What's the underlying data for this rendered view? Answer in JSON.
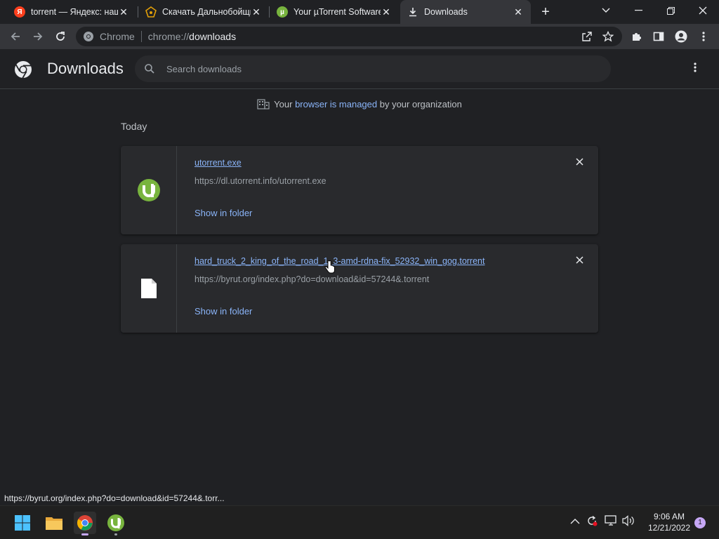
{
  "tabs": [
    {
      "title": "torrent — Яндекс: нашлось",
      "favicon": "yandex-icon",
      "favicon_glyph": "Я",
      "color": "#fc3f1d"
    },
    {
      "title": "Скачать Дальнобойщики",
      "favicon": "byrut-icon",
      "color": "#e3a008"
    },
    {
      "title": "Your µTorrent Software",
      "favicon": "utorrent-icon",
      "color": "#78b43e"
    },
    {
      "title": "Downloads",
      "favicon": "download-icon",
      "active": true
    }
  ],
  "omnibox": {
    "scheme": "Chrome",
    "url_prefix": "chrome://",
    "url_host": "downloads"
  },
  "header": {
    "title": "Downloads",
    "search_placeholder": "Search downloads"
  },
  "managed": {
    "before": "Your ",
    "link": "browser is managed",
    "after": " by your organization"
  },
  "section_label": "Today",
  "downloads": [
    {
      "filename": "utorrent.exe",
      "url": "https://dl.utorrent.info/utorrent.exe",
      "action": "Show in folder",
      "icon": "utorrent-icon"
    },
    {
      "filename": "hard_truck_2_king_of_the_road_1_3-amd-rdna-fix_52932_win_gog.torrent",
      "url": "https://byrut.org/index.php?do=download&id=57244&.torrent",
      "action": "Show in folder",
      "icon": "file-icon"
    }
  ],
  "status_url": "https://byrut.org/index.php?do=download&id=57244&.torr...",
  "taskbar": {
    "time": "9:06 AM",
    "date": "12/21/2022",
    "notification_count": "1"
  },
  "colors": {
    "accent_link": "#8ab4f8",
    "background": "#202124",
    "card": "#292a2d"
  }
}
